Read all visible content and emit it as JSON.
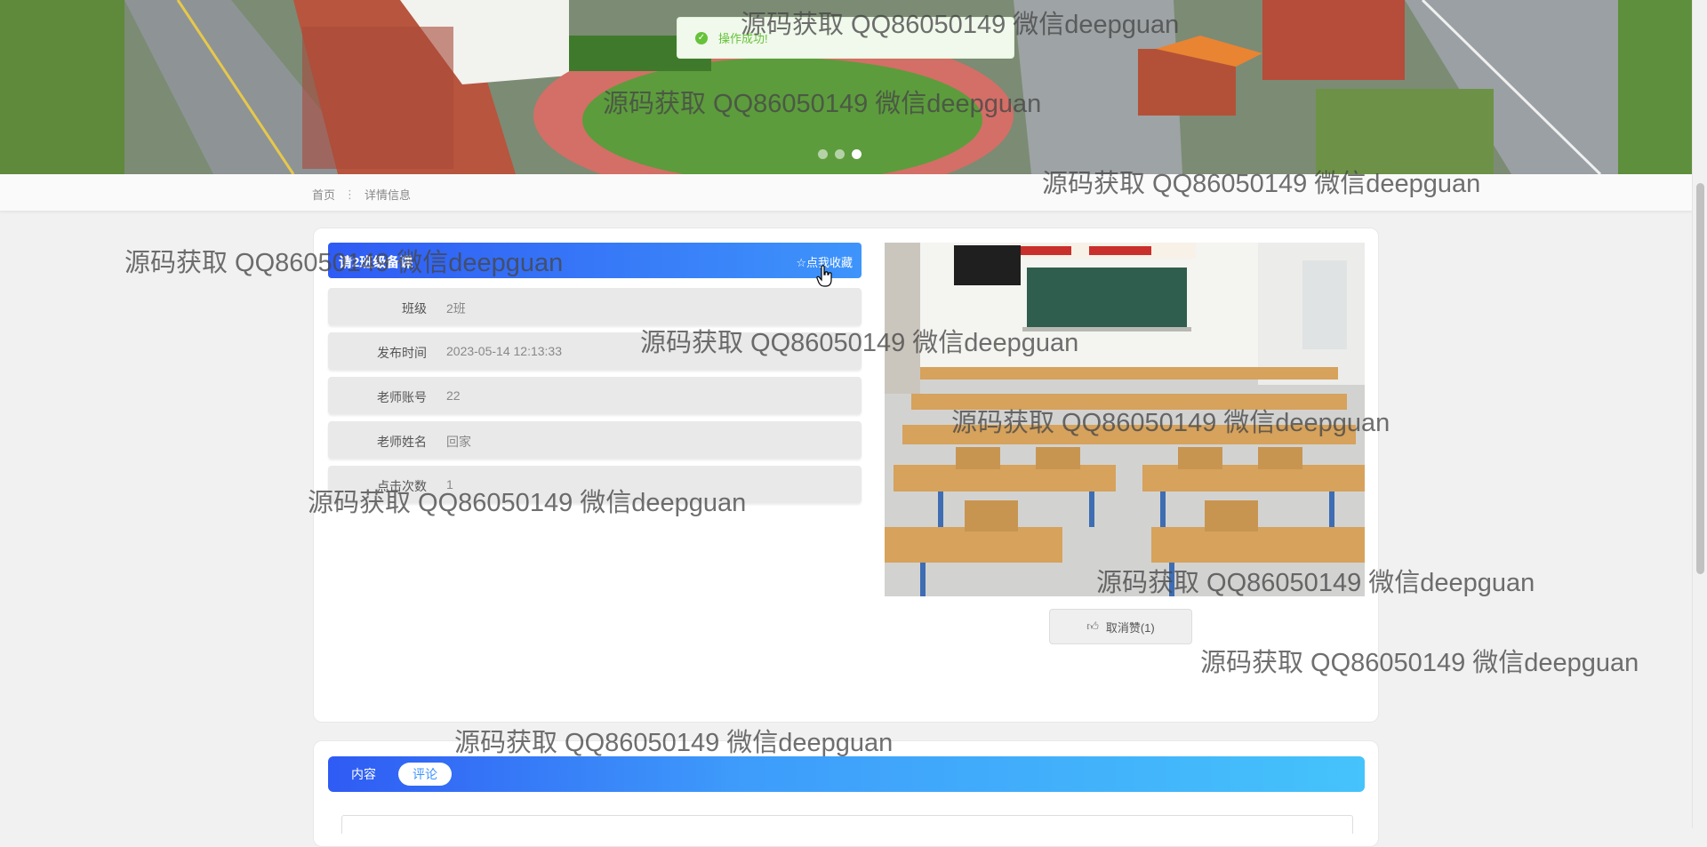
{
  "toast": {
    "message": "操作成功!"
  },
  "banner": {
    "slide_count": 3,
    "active_slide": 3
  },
  "breadcrumb": {
    "home": "首页",
    "separator": "⋮",
    "current": "详情信息"
  },
  "detail": {
    "title": "请2班级备课",
    "favorite_label": "☆点我收藏",
    "fields": [
      {
        "label": "班级",
        "value": "2班"
      },
      {
        "label": "发布时间",
        "value": "2023-05-14 12:13:33"
      },
      {
        "label": "老师账号",
        "value": "22"
      },
      {
        "label": "老师姓名",
        "value": "回家"
      },
      {
        "label": "点击次数",
        "value": "1"
      }
    ],
    "like_button": {
      "icon": "thumbs-up-icon",
      "label": "取消赞(1)"
    }
  },
  "tabs": [
    {
      "label": "内容"
    },
    {
      "label": "评论"
    }
  ],
  "watermark": "源码获取 QQ86050149 微信deepguan",
  "colors": {
    "accent_blue": "#3e94fb",
    "success_green": "#67c23a"
  }
}
